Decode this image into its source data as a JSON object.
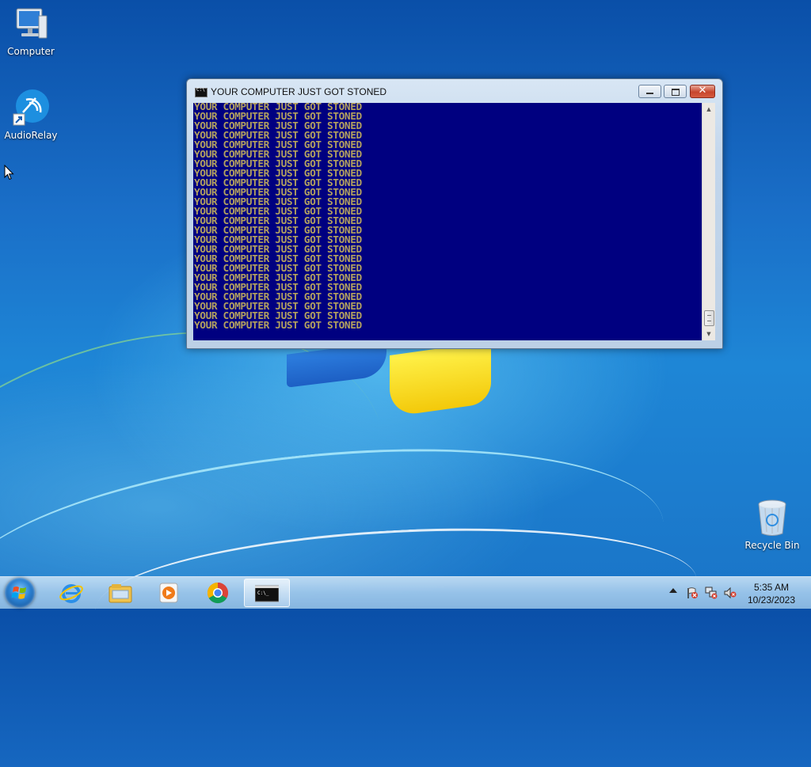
{
  "desktop": {
    "icons": [
      {
        "label": "Computer"
      },
      {
        "label": "AudioRelay"
      },
      {
        "label": "Recycle Bin"
      }
    ]
  },
  "window": {
    "title": "YOUR COMPUTER JUST GOT STONED",
    "console_lines": [
      "YOUR COMPUTER JUST GOT STONED",
      "YOUR COMPUTER JUST GOT STONED",
      "YOUR COMPUTER JUST GOT STONED",
      "YOUR COMPUTER JUST GOT STONED",
      "YOUR COMPUTER JUST GOT STONED",
      "YOUR COMPUTER JUST GOT STONED",
      "YOUR COMPUTER JUST GOT STONED",
      "YOUR COMPUTER JUST GOT STONED",
      "YOUR COMPUTER JUST GOT STONED",
      "YOUR COMPUTER JUST GOT STONED",
      "YOUR COMPUTER JUST GOT STONED",
      "YOUR COMPUTER JUST GOT STONED",
      "YOUR COMPUTER JUST GOT STONED",
      "YOUR COMPUTER JUST GOT STONED",
      "YOUR COMPUTER JUST GOT STONED",
      "YOUR COMPUTER JUST GOT STONED",
      "YOUR COMPUTER JUST GOT STONED",
      "YOUR COMPUTER JUST GOT STONED",
      "YOUR COMPUTER JUST GOT STONED",
      "YOUR COMPUTER JUST GOT STONED",
      "YOUR COMPUTER JUST GOT STONED",
      "YOUR COMPUTER JUST GOT STONED",
      "YOUR COMPUTER JUST GOT STONED",
      "YOUR COMPUTER JUST GOT STONED"
    ],
    "colors": {
      "console_background": "#000080",
      "console_text": "#b3a15f"
    }
  },
  "taskbar": {
    "pinned": [
      {
        "icon": "internet-explorer-icon"
      },
      {
        "icon": "file-explorer-icon"
      },
      {
        "icon": "media-player-icon"
      },
      {
        "icon": "chrome-icon"
      },
      {
        "icon": "command-prompt-icon",
        "active": true
      }
    ],
    "tray": {
      "icons": [
        "action-center-flag-icon",
        "network-icon",
        "volume-muted-icon"
      ],
      "time": "5:35 AM",
      "date": "10/23/2023"
    }
  }
}
